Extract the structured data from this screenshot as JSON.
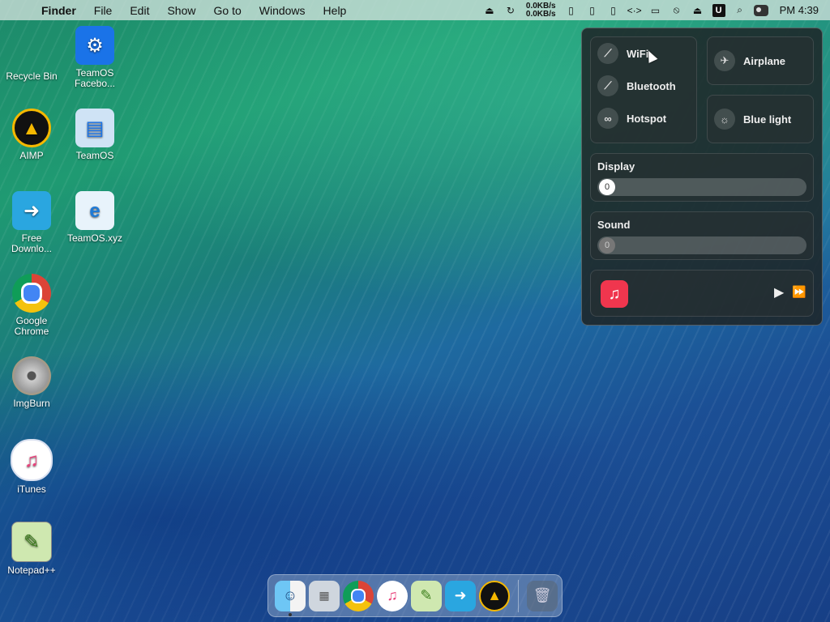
{
  "menubar": {
    "apple_glyph": "",
    "items": [
      "Finder",
      "File",
      "Edit",
      "Show",
      "Go to",
      "Windows",
      "Help"
    ],
    "net_up": "0.0KB/s",
    "net_down": "0.0KB/s",
    "badge": "U",
    "clock": "PM 4:39"
  },
  "desktop": {
    "icons": [
      {
        "label": "Recycle Bin",
        "icon": "recycle-bin-icon"
      },
      {
        "label": "TeamOS Facebo...",
        "icon": "gear-icon"
      },
      {
        "label": "AIMP",
        "icon": "aimp-icon"
      },
      {
        "label": "TeamOS",
        "icon": "teamos-icon"
      },
      {
        "label": "Free Downlo...",
        "icon": "download-manager-icon"
      },
      {
        "label": "TeamOS.xyz",
        "icon": "internet-explorer-icon"
      },
      {
        "label": "Google Chrome",
        "icon": "chrome-icon"
      },
      {
        "label": "ImgBurn",
        "icon": "imgburn-icon"
      },
      {
        "label": "iTunes",
        "icon": "itunes-icon"
      },
      {
        "label": "Notepad++",
        "icon": "notepad-plus-icon"
      }
    ]
  },
  "control_center": {
    "wifi": "WiFi",
    "bluetooth": "Bluetooth",
    "hotspot": "Hotspot",
    "airplane": "Airplane",
    "blue_light": "Blue light",
    "display_label": "Display",
    "display_value": "0",
    "sound_label": "Sound",
    "sound_value": "0"
  },
  "dock": {
    "items": [
      "finder-icon",
      "launchpad-icon",
      "chrome-icon",
      "itunes-icon",
      "notepad-plus-icon",
      "download-manager-icon",
      "aimp-icon",
      "trash-icon"
    ]
  },
  "colors": {
    "accent_green": "#1f9a72",
    "accent_blue": "#1b4f95",
    "music_red": "#f0364e"
  }
}
